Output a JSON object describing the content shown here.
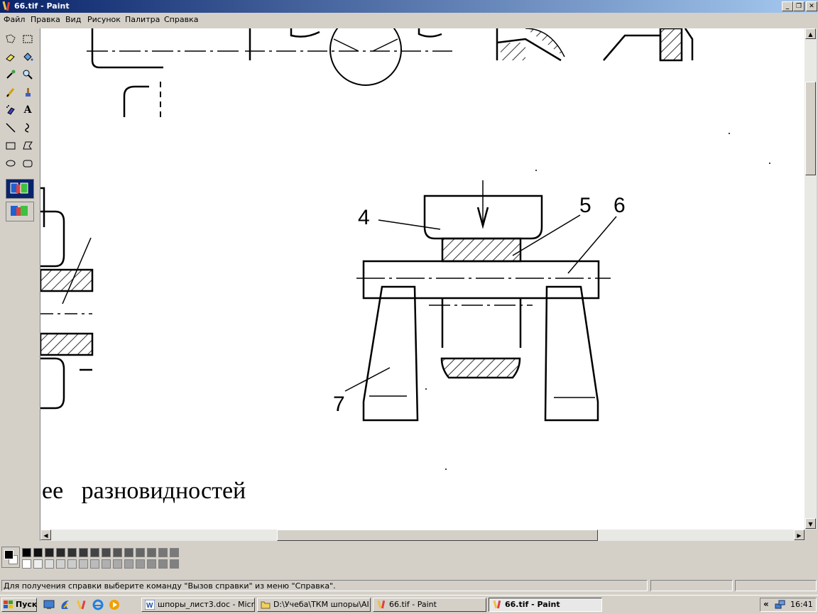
{
  "window": {
    "title": "66.tif - Paint"
  },
  "menu": {
    "items": [
      "Файл",
      "Правка",
      "Вид",
      "Рисунок",
      "Палитра",
      "Справка"
    ]
  },
  "toolbox": {
    "tools": [
      "free-form-select",
      "rect-select",
      "eraser",
      "fill",
      "pick-color",
      "magnifier",
      "pencil",
      "brush",
      "airbrush",
      "text",
      "line",
      "curve",
      "rectangle",
      "polygon",
      "ellipse",
      "rounded-rectangle"
    ],
    "text_tool_glyph": "A"
  },
  "drawing": {
    "labels": {
      "l4": "4",
      "l5": "5",
      "l6": "6",
      "l7": "7"
    },
    "caption": "ее   разновидностей"
  },
  "palette": {
    "colors_top": [
      "#000000",
      "#111111",
      "#222222",
      "#2a2a2a",
      "#333333",
      "#3a3a3a",
      "#444444",
      "#4a4a4a",
      "#555555",
      "#5a5a5a",
      "#666666",
      "#6a6a6a",
      "#777777",
      "#7a7a7a"
    ],
    "colors_bottom": [
      "#ffffff",
      "#eeeeee",
      "#dddddd",
      "#d0d0d0",
      "#cccccc",
      "#c0c0c0",
      "#bbbbbb",
      "#b0b0b0",
      "#aaaaaa",
      "#a0a0a0",
      "#999999",
      "#909090",
      "#888888",
      "#808080"
    ]
  },
  "status": {
    "text": "Для получения справки выберите команду \"Вызов справки\" из меню \"Справка\"."
  },
  "taskbar": {
    "start_label": "Пуск",
    "tasks": [
      "шпоры_лист3.doc - Micr...",
      "D:\\Учеба\\ТКМ шпоры\\АI",
      "66.tif - Paint",
      "66.tif - Paint"
    ],
    "clock": "16:41",
    "tray_chevron": "«"
  }
}
